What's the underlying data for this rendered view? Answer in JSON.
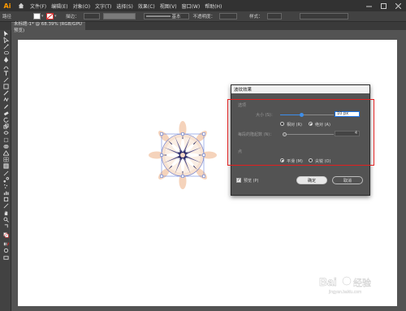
{
  "app": {
    "logo": "Ai"
  },
  "menu": {
    "items": [
      "文件(F)",
      "编辑(E)",
      "对象(O)",
      "文字(T)",
      "选择(S)",
      "效果(C)",
      "视图(V)",
      "窗口(W)",
      "帮助(H)"
    ]
  },
  "controlbar": {
    "group_label": "路径",
    "stroke_label": "描边：",
    "stroke_style": "基本",
    "opacity_label": "不透明度：",
    "style_label": "样式："
  },
  "document_tab": {
    "title": "未标题-1* @ 68.39% (RGB/GPU 预览)"
  },
  "dialog": {
    "title": "波纹效果",
    "options_label": "选项",
    "size_label": "大小 (S)：",
    "size_value": "10 px",
    "relative_label": "相对 (R)",
    "absolute_label": "绝对 (A)",
    "ridges_label": "每段的隆起数 (N)：",
    "ridges_value": "4",
    "point_label": "点",
    "smooth_label": "平滑 (M)",
    "corner_label": "尖锐 (O)",
    "preview_label": "预览 (P)",
    "ok_label": "确定",
    "cancel_label": "取消",
    "size_slider_fraction": 0.4,
    "ridges_slider_fraction": 0.0,
    "selected_mode": "absolute",
    "selected_point": "smooth",
    "preview_checked": true
  },
  "watermark": {
    "text": "Bai 经验",
    "url_text": "jingyan.baidu.com"
  },
  "colors": {
    "accent_blue": "#3d8eea",
    "highlight_red": "#e02020",
    "logo_orange": "#ff9a00",
    "flower_peach": "#f2c4a4",
    "flower_navy": "#1c1c55"
  },
  "icons": {
    "home": "home-icon",
    "minimize": "minimize-icon",
    "maximize": "maximize-icon",
    "close": "close-icon"
  }
}
